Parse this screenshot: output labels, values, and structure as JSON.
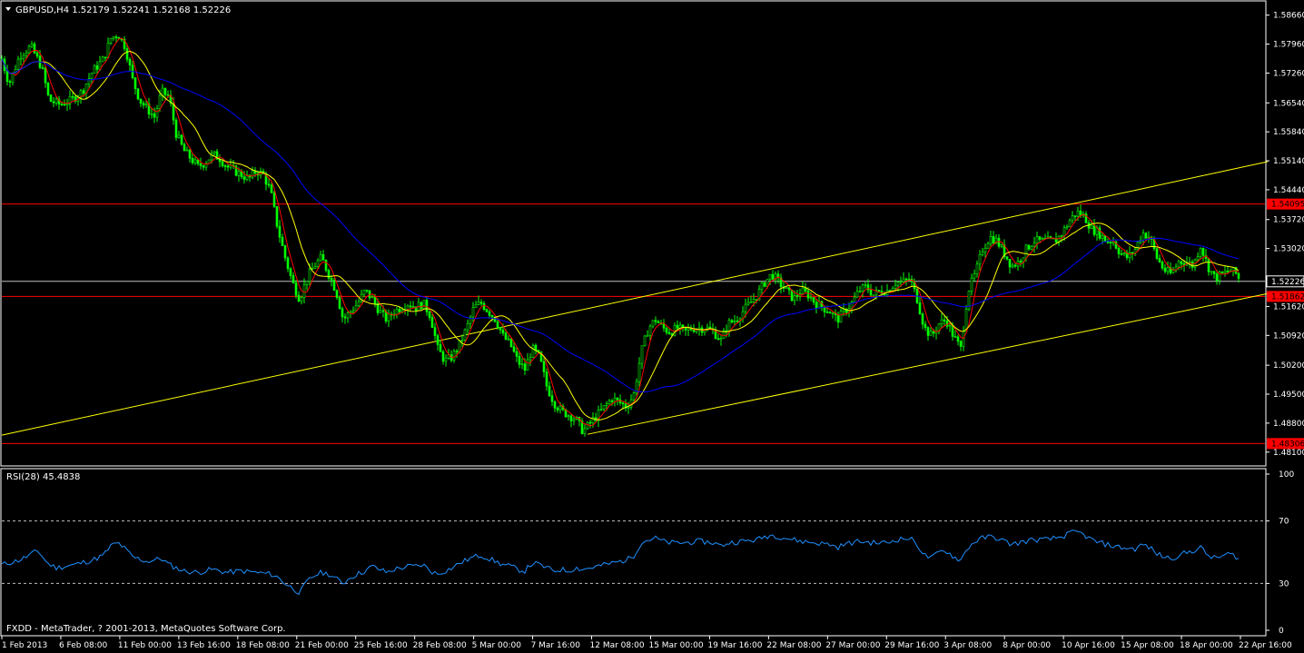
{
  "header": {
    "symbol_line": "GBPUSD,H4  1.52179 1.52241 1.52168 1.52226",
    "rsi_label": "RSI(28) 45.4838",
    "copyright": "FXDD - MetaTrader, ? 2001-2013, MetaQuotes Software Corp."
  },
  "colors": {
    "background": "#000000",
    "frame": "#ffffff",
    "bull_candle": "#00ff00",
    "bear_candle": "#00ff00",
    "fast_ma": "#ff0000",
    "slow_ma": "#ffff00",
    "long_ma": "#0000ff",
    "channel": "#ffff00",
    "horizontal_level": "#ff0000",
    "bid_line": "#c0c0c0",
    "rsi_line": "#1e90ff",
    "rsi_levels": "#c0c0c0"
  },
  "chart_data": [
    {
      "type": "candlestick",
      "name": "GBPUSD,H4",
      "ylim": [
        1.4781,
        1.5896
      ],
      "y_ticks": [
        "1.58660",
        "1.57960",
        "1.57260",
        "1.56540",
        "1.55840",
        "1.55140",
        "1.54440",
        "1.53720",
        "1.53020",
        "1.52226",
        "1.51620",
        "1.50920",
        "1.50200",
        "1.49500",
        "1.48800",
        "1.48100"
      ],
      "x_ticks": [
        "1 Feb 2013",
        "6 Feb 08:00",
        "11 Feb 00:00",
        "13 Feb 16:00",
        "18 Feb 08:00",
        "21 Feb 00:00",
        "25 Feb 16:00",
        "28 Feb 08:00",
        "5 Mar 00:00",
        "7 Mar 16:00",
        "12 Mar 08:00",
        "15 Mar 00:00",
        "19 Mar 16:00",
        "22 Mar 08:00",
        "27 Mar 00:00",
        "29 Mar 16:00",
        "3 Apr 08:00",
        "8 Apr 00:00",
        "10 Apr 16:00",
        "15 Apr 08:00",
        "18 Apr 00:00",
        "22 Apr 16:00"
      ],
      "close_path": [
        [
          0,
          1.576
        ],
        [
          8,
          1.57
        ],
        [
          20,
          1.577
        ],
        [
          32,
          1.579
        ],
        [
          44,
          1.574
        ],
        [
          52,
          1.566
        ],
        [
          64,
          1.565
        ],
        [
          76,
          1.566
        ],
        [
          88,
          1.568
        ],
        [
          100,
          1.573
        ],
        [
          112,
          1.576
        ],
        [
          120,
          1.581
        ],
        [
          128,
          1.582
        ],
        [
          136,
          1.579
        ],
        [
          144,
          1.571
        ],
        [
          152,
          1.566
        ],
        [
          160,
          1.564
        ],
        [
          168,
          1.562
        ],
        [
          176,
          1.568
        ],
        [
          184,
          1.567
        ],
        [
          192,
          1.558
        ],
        [
          200,
          1.554
        ],
        [
          208,
          1.552
        ],
        [
          216,
          1.55
        ],
        [
          224,
          1.551
        ],
        [
          232,
          1.553
        ],
        [
          240,
          1.552
        ],
        [
          248,
          1.55
        ],
        [
          256,
          1.549
        ],
        [
          264,
          1.548
        ],
        [
          272,
          1.547
        ],
        [
          280,
          1.549
        ],
        [
          288,
          1.548
        ],
        [
          296,
          1.544
        ],
        [
          304,
          1.535
        ],
        [
          312,
          1.528
        ],
        [
          320,
          1.522
        ],
        [
          328,
          1.518
        ],
        [
          336,
          1.523
        ],
        [
          344,
          1.526
        ],
        [
          352,
          1.528
        ],
        [
          360,
          1.524
        ],
        [
          368,
          1.52
        ],
        [
          376,
          1.513
        ],
        [
          384,
          1.515
        ],
        [
          392,
          1.517
        ],
        [
          400,
          1.52
        ],
        [
          408,
          1.518
        ],
        [
          416,
          1.515
        ],
        [
          424,
          1.513
        ],
        [
          432,
          1.515
        ],
        [
          440,
          1.516
        ],
        [
          448,
          1.517
        ],
        [
          456,
          1.516
        ],
        [
          464,
          1.517
        ],
        [
          472,
          1.514
        ],
        [
          480,
          1.506
        ],
        [
          488,
          1.503
        ],
        [
          496,
          1.504
        ],
        [
          504,
          1.507
        ],
        [
          512,
          1.511
        ],
        [
          520,
          1.516
        ],
        [
          528,
          1.517
        ],
        [
          536,
          1.515
        ],
        [
          544,
          1.513
        ],
        [
          552,
          1.509
        ],
        [
          560,
          1.507
        ],
        [
          568,
          1.503
        ],
        [
          576,
          1.501
        ],
        [
          584,
          1.506
        ],
        [
          592,
          1.504
        ],
        [
          600,
          1.497
        ],
        [
          608,
          1.493
        ],
        [
          616,
          1.491
        ],
        [
          624,
          1.49
        ],
        [
          632,
          1.489
        ],
        [
          640,
          1.486
        ],
        [
          648,
          1.488
        ],
        [
          656,
          1.49
        ],
        [
          664,
          1.492
        ],
        [
          672,
          1.494
        ],
        [
          680,
          1.493
        ],
        [
          688,
          1.492
        ],
        [
          696,
          1.495
        ],
        [
          704,
          1.505
        ],
        [
          712,
          1.511
        ],
        [
          720,
          1.513
        ],
        [
          728,
          1.511
        ],
        [
          736,
          1.51
        ],
        [
          744,
          1.511
        ],
        [
          752,
          1.51
        ],
        [
          760,
          1.511
        ],
        [
          768,
          1.511
        ],
        [
          776,
          1.511
        ],
        [
          784,
          1.51
        ],
        [
          792,
          1.508
        ],
        [
          800,
          1.512
        ],
        [
          808,
          1.513
        ],
        [
          816,
          1.515
        ],
        [
          824,
          1.517
        ],
        [
          832,
          1.519
        ],
        [
          840,
          1.522
        ],
        [
          848,
          1.524
        ],
        [
          856,
          1.522
        ],
        [
          864,
          1.52
        ],
        [
          872,
          1.518
        ],
        [
          880,
          1.52
        ],
        [
          888,
          1.519
        ],
        [
          896,
          1.517
        ],
        [
          904,
          1.516
        ],
        [
          912,
          1.515
        ],
        [
          920,
          1.513
        ],
        [
          928,
          1.515
        ],
        [
          936,
          1.517
        ],
        [
          944,
          1.52
        ],
        [
          952,
          1.521
        ],
        [
          960,
          1.519
        ],
        [
          968,
          1.52
        ],
        [
          976,
          1.52
        ],
        [
          984,
          1.522
        ],
        [
          992,
          1.522
        ],
        [
          1000,
          1.523
        ],
        [
          1008,
          1.518
        ],
        [
          1016,
          1.511
        ],
        [
          1024,
          1.509
        ],
        [
          1032,
          1.512
        ],
        [
          1040,
          1.513
        ],
        [
          1048,
          1.509
        ],
        [
          1056,
          1.506
        ],
        [
          1064,
          1.52
        ],
        [
          1072,
          1.524
        ],
        [
          1080,
          1.53
        ],
        [
          1088,
          1.533
        ],
        [
          1096,
          1.532
        ],
        [
          1104,
          1.529
        ],
        [
          1112,
          1.526
        ],
        [
          1120,
          1.527
        ],
        [
          1128,
          1.53
        ],
        [
          1136,
          1.532
        ],
        [
          1144,
          1.532
        ],
        [
          1152,
          1.532
        ],
        [
          1160,
          1.532
        ],
        [
          1168,
          1.534
        ],
        [
          1176,
          1.537
        ],
        [
          1184,
          1.539
        ],
        [
          1192,
          1.538
        ],
        [
          1200,
          1.535
        ],
        [
          1208,
          1.534
        ],
        [
          1216,
          1.532
        ],
        [
          1224,
          1.532
        ],
        [
          1232,
          1.529
        ],
        [
          1240,
          1.528
        ],
        [
          1248,
          1.53
        ],
        [
          1256,
          1.534
        ],
        [
          1264,
          1.533
        ],
        [
          1272,
          1.528
        ],
        [
          1280,
          1.525
        ],
        [
          1288,
          1.524
        ],
        [
          1296,
          1.527
        ],
        [
          1304,
          1.527
        ],
        [
          1312,
          1.526
        ],
        [
          1320,
          1.531
        ],
        [
          1328,
          1.526
        ],
        [
          1336,
          1.523
        ],
        [
          1344,
          1.524
        ],
        [
          1352,
          1.525
        ],
        [
          1360,
          1.524
        ],
        [
          1364,
          1.522
        ]
      ],
      "indicators": [
        {
          "id": "fast_ma",
          "type": "moving_average",
          "period": 5
        },
        {
          "id": "slow_ma",
          "type": "moving_average",
          "period": 14
        },
        {
          "id": "long_ma",
          "type": "moving_average",
          "period": 50
        }
      ],
      "horizontal_levels": [
        {
          "value": 1.54095,
          "label": "1.54095",
          "kind": "resistance"
        },
        {
          "value": 1.51862,
          "label": "1.51862",
          "kind": "support"
        },
        {
          "value": 1.48306,
          "label": "1.48306",
          "kind": "support"
        },
        {
          "value": 1.52226,
          "label": "1.52226",
          "kind": "bid"
        }
      ],
      "trendlines": [
        {
          "from": [
            0,
            1.4851
          ],
          "to": [
            1394,
            1.5512
          ]
        },
        {
          "from": [
            645,
            1.4853
          ],
          "to": [
            1394,
            1.5193
          ]
        }
      ]
    },
    {
      "type": "line",
      "name": "RSI(28)",
      "ylim": [
        0,
        100
      ],
      "y_ticks": [
        "100",
        "70",
        "30",
        "0"
      ],
      "levels": [
        70,
        30
      ],
      "values": [
        [
          0,
          42
        ],
        [
          20,
          45
        ],
        [
          40,
          51
        ],
        [
          50,
          43
        ],
        [
          60,
          40
        ],
        [
          80,
          42
        ],
        [
          100,
          45
        ],
        [
          112,
          48
        ],
        [
          120,
          54
        ],
        [
          128,
          56
        ],
        [
          136,
          52
        ],
        [
          144,
          47
        ],
        [
          160,
          44
        ],
        [
          176,
          46
        ],
        [
          184,
          42
        ],
        [
          200,
          38
        ],
        [
          216,
          37
        ],
        [
          232,
          39
        ],
        [
          248,
          37
        ],
        [
          264,
          38
        ],
        [
          280,
          37
        ],
        [
          296,
          36
        ],
        [
          304,
          34
        ],
        [
          312,
          30
        ],
        [
          320,
          27
        ],
        [
          328,
          24
        ],
        [
          336,
          31
        ],
        [
          344,
          35
        ],
        [
          352,
          37
        ],
        [
          360,
          36
        ],
        [
          368,
          33
        ],
        [
          376,
          30
        ],
        [
          384,
          34
        ],
        [
          392,
          36
        ],
        [
          400,
          38
        ],
        [
          408,
          41
        ],
        [
          416,
          39
        ],
        [
          424,
          37
        ],
        [
          432,
          39
        ],
        [
          440,
          40
        ],
        [
          448,
          41
        ],
        [
          456,
          41
        ],
        [
          464,
          42
        ],
        [
          472,
          38
        ],
        [
          480,
          36
        ],
        [
          488,
          38
        ],
        [
          496,
          40
        ],
        [
          504,
          43
        ],
        [
          512,
          45
        ],
        [
          520,
          47
        ],
        [
          528,
          48
        ],
        [
          536,
          46
        ],
        [
          544,
          44
        ],
        [
          552,
          42
        ],
        [
          560,
          41
        ],
        [
          568,
          39
        ],
        [
          576,
          38
        ],
        [
          584,
          43
        ],
        [
          592,
          42
        ],
        [
          600,
          40
        ],
        [
          608,
          38
        ],
        [
          616,
          39
        ],
        [
          624,
          38
        ],
        [
          632,
          40
        ],
        [
          640,
          39
        ],
        [
          656,
          41
        ],
        [
          672,
          43
        ],
        [
          688,
          45
        ],
        [
          696,
          48
        ],
        [
          704,
          56
        ],
        [
          712,
          58
        ],
        [
          720,
          59
        ],
        [
          728,
          57
        ],
        [
          736,
          56
        ],
        [
          752,
          56
        ],
        [
          768,
          57
        ],
        [
          784,
          56
        ],
        [
          792,
          54
        ],
        [
          800,
          56
        ],
        [
          816,
          57
        ],
        [
          832,
          58
        ],
        [
          840,
          60
        ],
        [
          848,
          61
        ],
        [
          864,
          59
        ],
        [
          880,
          57
        ],
        [
          896,
          56
        ],
        [
          912,
          55
        ],
        [
          920,
          53
        ],
        [
          928,
          55
        ],
        [
          944,
          57
        ],
        [
          960,
          56
        ],
        [
          976,
          56
        ],
        [
          984,
          58
        ],
        [
          1000,
          59
        ],
        [
          1008,
          55
        ],
        [
          1016,
          48
        ],
        [
          1024,
          46
        ],
        [
          1032,
          50
        ],
        [
          1040,
          51
        ],
        [
          1048,
          47
        ],
        [
          1056,
          45
        ],
        [
          1064,
          53
        ],
        [
          1072,
          57
        ],
        [
          1080,
          59
        ],
        [
          1088,
          60
        ],
        [
          1096,
          59
        ],
        [
          1104,
          57
        ],
        [
          1112,
          55
        ],
        [
          1120,
          56
        ],
        [
          1136,
          58
        ],
        [
          1152,
          58
        ],
        [
          1168,
          60
        ],
        [
          1176,
          62
        ],
        [
          1184,
          63
        ],
        [
          1192,
          61
        ],
        [
          1200,
          58
        ],
        [
          1208,
          56
        ],
        [
          1216,
          55
        ],
        [
          1232,
          53
        ],
        [
          1248,
          52
        ],
        [
          1256,
          55
        ],
        [
          1264,
          53
        ],
        [
          1272,
          49
        ],
        [
          1280,
          47
        ],
        [
          1288,
          46
        ],
        [
          1296,
          48
        ],
        [
          1312,
          51
        ],
        [
          1320,
          53
        ],
        [
          1328,
          48
        ],
        [
          1336,
          46
        ],
        [
          1352,
          49
        ],
        [
          1360,
          47
        ],
        [
          1364,
          45
        ]
      ]
    }
  ]
}
